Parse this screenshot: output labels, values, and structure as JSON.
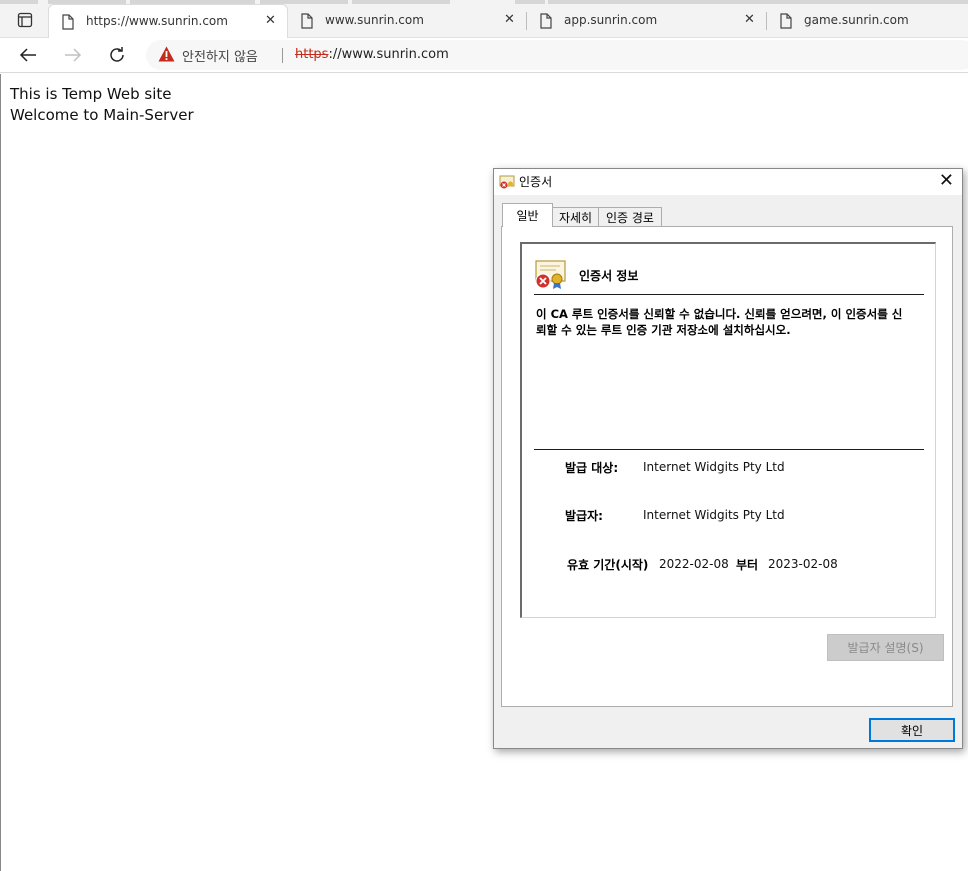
{
  "browser": {
    "tabs": [
      {
        "label": "https://www.sunrin.com",
        "active": true
      },
      {
        "label": "www.sunrin.com",
        "active": false
      },
      {
        "label": "app.sunrin.com",
        "active": false
      },
      {
        "label": "game.sunrin.com",
        "active": false
      }
    ],
    "close_glyph": "✕",
    "security_label": "안전하지 않음",
    "url": {
      "scheme": "https",
      "rest": "://www.sunrin.com"
    }
  },
  "page": {
    "line1": "This is Temp Web site",
    "line2": "Welcome to Main-Server"
  },
  "dialog": {
    "title": "인증서",
    "close_glyph": "✕",
    "tabs": [
      "일반",
      "자세히",
      "인증 경로"
    ],
    "active_tab": "일반",
    "info_heading": "인증서 정보",
    "message": "이 CA 루트 인증서를 신뢰할 수 없습니다. 신뢰를 얻으려면, 이 인증서를 신뢰할 수 있는 루트 인증 기관 저장소에 설치하십시오.",
    "issued_to_label": "발급 대상:",
    "issued_to_value": "Internet Widgits Pty Ltd",
    "issued_by_label": "발급자:",
    "issued_by_value": "Internet Widgits Pty Ltd",
    "validity_label": "유효 기간(시작)",
    "valid_from": "2022-02-08",
    "valid_to_label": "부터",
    "valid_to": "2023-02-08",
    "issuer_statement_button": "발급자 설명(S)",
    "ok_button": "확인"
  },
  "colors": {
    "warning_red": "#c42b1c",
    "focus_blue": "#0078d7",
    "disabled_button": "#cccccc"
  }
}
